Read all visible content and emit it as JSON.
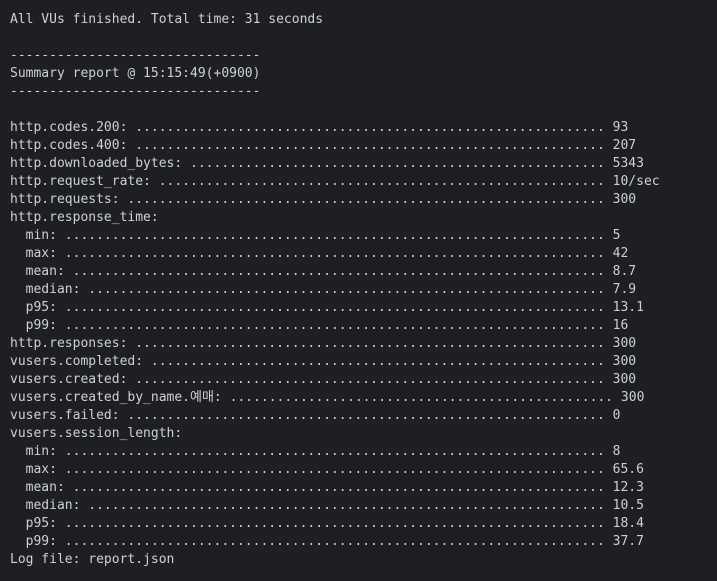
{
  "terminal": {
    "finished_line": "All VUs finished. Total time: 31 seconds",
    "separator_top": "--------------------------------",
    "summary_header": "Summary report @ 15:15:49(+0900)",
    "separator_bottom": "--------------------------------",
    "metrics": [
      "http.codes.200: ............................................................ 93",
      "http.codes.400: ............................................................ 207",
      "http.downloaded_bytes: ..................................................... 5343",
      "http.request_rate: ......................................................... 10/sec",
      "http.requests: ............................................................. 300",
      "http.response_time:",
      "  min: ..................................................................... 5",
      "  max: ..................................................................... 42",
      "  mean: .................................................................... 8.7",
      "  median: .................................................................. 7.9",
      "  p95: ..................................................................... 13.1",
      "  p99: ..................................................................... 16",
      "http.responses: ............................................................ 300",
      "vusers.completed: .......................................................... 300",
      "vusers.created: ............................................................ 300",
      "vusers.created_by_name.예매: ................................................. 300",
      "vusers.failed: ............................................................. 0",
      "vusers.session_length:",
      "  min: ..................................................................... 8",
      "  max: ..................................................................... 65.6",
      "  mean: .................................................................... 12.3",
      "  median: .................................................................. 10.5",
      "  p95: ..................................................................... 18.4",
      "  p99: ..................................................................... 37.7"
    ],
    "log_line": "Log file: report.json"
  }
}
